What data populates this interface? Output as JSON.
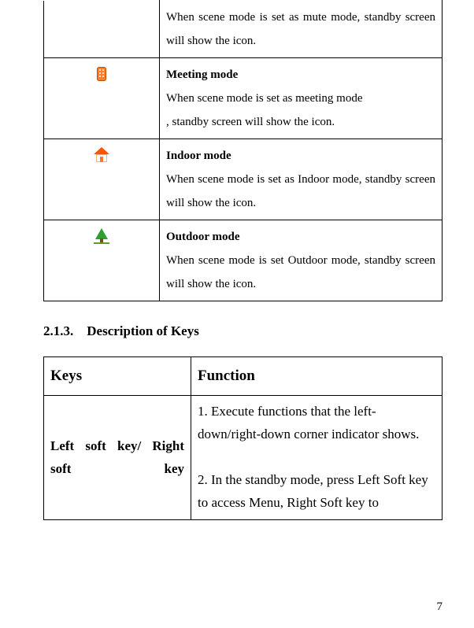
{
  "icons_table": {
    "rows": [
      {
        "icon": "",
        "desc": "When scene mode is set as mute mode, standby screen will show the icon."
      },
      {
        "icon": "meeting",
        "title": "Meeting mode",
        "desc_line1": "When scene mode is set as meeting mode",
        "desc_line2": ", standby screen will show the icon."
      },
      {
        "icon": "house",
        "title": "Indoor mode",
        "desc": "When scene mode is set as Indoor mode, standby screen will show the icon."
      },
      {
        "icon": "tree",
        "title": "Outdoor mode",
        "desc": "When scene mode is set Outdoor mode, standby screen will show the icon."
      }
    ]
  },
  "section_heading_number": "2.1.3.",
  "section_heading_title": "Description of Keys",
  "keys_table": {
    "header": {
      "col1": "Keys",
      "col2": "Function"
    },
    "rows": [
      {
        "key": "Left soft key/ Right soft key",
        "func_line1": "1. Execute functions that the left-down/right-down corner indicator shows.",
        "func_line2": "2. In the standby mode, press Left Soft key to access Menu, Right Soft key to"
      }
    ]
  },
  "page_number": "7"
}
